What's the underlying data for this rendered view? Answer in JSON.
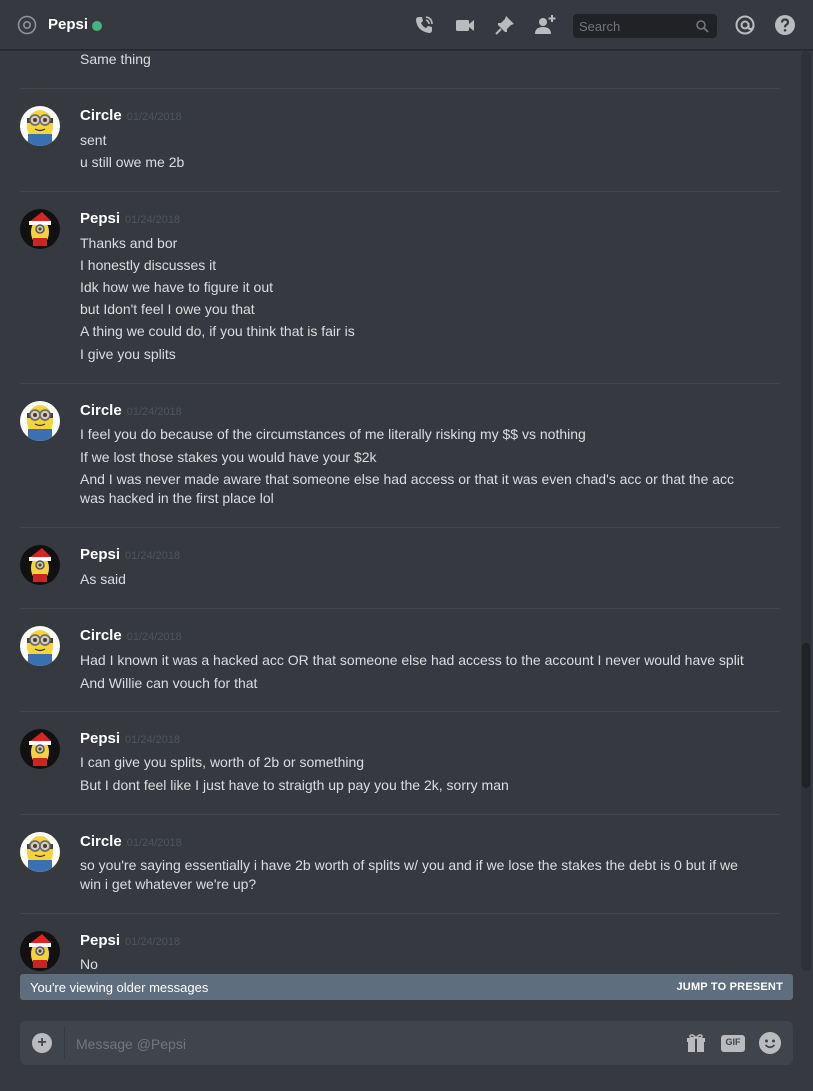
{
  "header": {
    "channel_name": "Pepsi",
    "status": "online",
    "status_color": "#43b581",
    "icons": [
      "at-icon",
      "call-icon",
      "video-icon",
      "pin-icon",
      "add-friend-icon",
      "search-icon",
      "mentions-icon",
      "help-icon"
    ],
    "search_placeholder": "Search"
  },
  "messages": [
    {
      "lines": [
        "Same thing"
      ]
    },
    {
      "author": "Circle",
      "timestamp": "01/24/2018",
      "avatar": "minion",
      "lines": [
        "sent",
        "u still owe me 2b"
      ]
    },
    {
      "author": "Pepsi",
      "timestamp": "01/24/2018",
      "avatar": "minion-santa",
      "lines": [
        "Thanks and bor",
        "I honestly discusses it",
        "Idk how we have to figure it out",
        "but  Idon't feel I owe you that",
        "A thing we could do, if you think that is fair is",
        "I give you splits"
      ]
    },
    {
      "author": "Circle",
      "timestamp": "01/24/2018",
      "avatar": "minion",
      "lines": [
        "I feel you do because of the circumstances of me literally risking my $$ vs nothing",
        "If we lost those stakes you would have your $2k",
        "And I was never made aware that someone else had access or that it was even chad's acc or that the acc",
        "was hacked in the first place lol"
      ]
    },
    {
      "author": "Pepsi",
      "timestamp": "01/24/2018",
      "avatar": "minion-santa",
      "lines": [
        "As said"
      ]
    },
    {
      "author": "Circle",
      "timestamp": "01/24/2018",
      "avatar": "minion",
      "lines": [
        "Had I known it was a hacked acc OR that someone else had access to the account I never would have split",
        "And Willie can vouch for that"
      ]
    },
    {
      "author": "Pepsi",
      "timestamp": "01/24/2018",
      "avatar": "minion-santa",
      "lines": [
        "I can give you splits, worth of 2b or something",
        "But I dont feel like I just have to straigth up pay you the 2k, sorry man"
      ]
    },
    {
      "author": "Circle",
      "timestamp": "01/24/2018",
      "avatar": "minion",
      "lines": [
        "so you're saying essentially i have 2b worth of splits w/ you and if we lose the stakes the debt is 0 but if we",
        "win i get whatever we're up?"
      ]
    },
    {
      "author": "Pepsi",
      "timestamp": "01/24/2018",
      "avatar": "minion-santa",
      "lines": [
        "No"
      ]
    }
  ],
  "older_bar": {
    "text": "You're viewing older messages",
    "jump_label": "JUMP TO PRESENT",
    "color": "#5f6e7f"
  },
  "composer": {
    "placeholder": "Message @Pepsi",
    "gif_label": "GIF",
    "plus_label": "+",
    "icons": [
      "add-attachment-icon",
      "gift-icon",
      "gif-icon",
      "emoji-icon"
    ]
  },
  "colors": {
    "background": "#36393f",
    "composer": "#40444b",
    "text": "#dcddde",
    "timestamp": "#4f545c"
  }
}
